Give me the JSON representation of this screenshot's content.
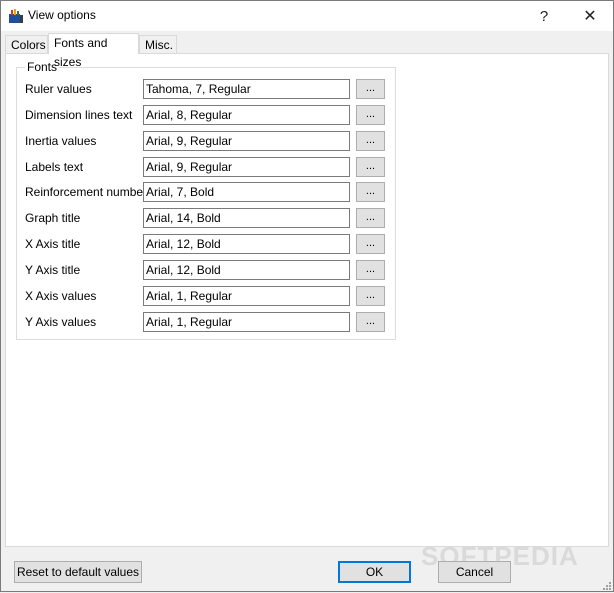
{
  "window": {
    "title": "View options",
    "help_glyph": "?",
    "close_glyph": "✕"
  },
  "tabs": [
    {
      "label": "Colors",
      "active": false
    },
    {
      "label": "Fonts and sizes",
      "active": true
    },
    {
      "label": "Misc.",
      "active": false
    }
  ],
  "fonts_group": {
    "legend": "Fonts",
    "browse_label": "...",
    "rows": [
      {
        "label": "Ruler values",
        "value": "Tahoma, 7, Regular"
      },
      {
        "label": "Dimension lines text",
        "value": "Arial, 8, Regular"
      },
      {
        "label": "Inertia values",
        "value": "Arial, 9, Regular"
      },
      {
        "label": "Labels text",
        "value": "Arial, 9, Regular"
      },
      {
        "label": "Reinforcement number",
        "value": "Arial, 7, Bold"
      },
      {
        "label": "Graph title",
        "value": "Arial, 14, Bold"
      },
      {
        "label": "X Axis title",
        "value": "Arial, 12, Bold"
      },
      {
        "label": "Y Axis title",
        "value": "Arial, 12, Bold"
      },
      {
        "label": "X Axis values",
        "value": "Arial, 1, Regular"
      },
      {
        "label": "Y Axis values",
        "value": "Arial, 1, Regular"
      }
    ]
  },
  "footer": {
    "reset_label": "Reset to default values",
    "ok_label": "OK",
    "cancel_label": "Cancel"
  },
  "watermark": "SOFTPEDIA",
  "colors": {
    "ok_border": "#0078d7",
    "button_face": "#e1e1e1",
    "window_bg": "#f0f0f0"
  }
}
